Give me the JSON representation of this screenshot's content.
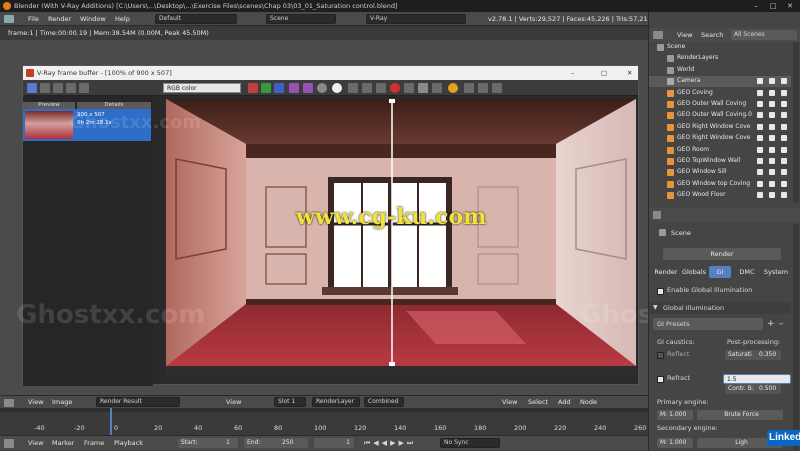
{
  "window": {
    "title": "Blender (With V-Ray Additions) [C:\\Users\\...\\Desktop\\...\\Exercise Files\\scenes\\Chap 03\\03_01_Saturation control.blend]",
    "minimize": "–",
    "maximize": "□",
    "close": "✕"
  },
  "infobar": {
    "menus": [
      "File",
      "Render",
      "Window",
      "Help"
    ],
    "layout": "Default",
    "scene": "Scene",
    "engine": "V-Ray",
    "stats": "v2.78.1 | Verts:29,527 | Faces:45,226 | Tris:57,210 | Objects:1/49 | Lamps:0/3 | Mem:38.56M | Camera"
  },
  "viewport": {
    "header": "frame:1 | Time:00:00.19 | Mem:38.54M (0.00M, Peak 45.50M)"
  },
  "vfb": {
    "title": "V-Ray frame buffer - [100% of 900 x 507]",
    "channel": "RGB color",
    "history": {
      "preview_label": "Preview",
      "details_label": "Details",
      "size": "900 x 507",
      "time": "0h 2m 28.1s"
    }
  },
  "outliner": {
    "tabs": [
      "View",
      "Search",
      "All Scenes"
    ],
    "items": [
      {
        "label": "Scene",
        "indent": 0
      },
      {
        "label": "RenderLayers",
        "indent": 1
      },
      {
        "label": "World",
        "indent": 1
      },
      {
        "label": "Camera",
        "indent": 1
      },
      {
        "label": "GEO Coving",
        "indent": 1
      },
      {
        "label": "GEO Outer Wall Coving",
        "indent": 1
      },
      {
        "label": "GEO Outer Wall Coving.0",
        "indent": 1
      },
      {
        "label": "GEO Right Window Cove",
        "indent": 1
      },
      {
        "label": "GEO Right Window Cove",
        "indent": 1
      },
      {
        "label": "GEO Room",
        "indent": 1
      },
      {
        "label": "GEO TopWindow Wall",
        "indent": 1
      },
      {
        "label": "GEO Window Sill",
        "indent": 1
      },
      {
        "label": "GEO Window top Coving",
        "indent": 1
      },
      {
        "label": "GEO Wood Floor",
        "indent": 1
      }
    ]
  },
  "properties": {
    "breadcrumb": "Scene",
    "render_button": "Render",
    "tabs": [
      "Render",
      "Globals",
      "GI",
      "DMC",
      "System"
    ],
    "active_tab": "GI",
    "enable_gi": "Enable Global Illumination",
    "panel_title": "Global Illumination",
    "gi_presets": "GI Presets",
    "gi_caustics": "GI caustics:",
    "reflect": "Reflect",
    "refract": "Refract",
    "post_processing": "Post-processing:",
    "saturation_label": "Saturati",
    "saturation_value": "0.350",
    "contrast_field": "1.5",
    "contrast_base_label": "Contr. B:",
    "contrast_base_value": "0.500",
    "primary_engine": "Primary engine:",
    "primary_mult": "M: 1.000",
    "primary_value": "Brute Force",
    "secondary_engine": "Secondary engine:",
    "secondary_mult": "M: 1.000",
    "secondary_value": "Ligh"
  },
  "uv_header": {
    "left": [
      "View",
      "Image"
    ],
    "render_result": "Render Result",
    "mid": [
      "View"
    ],
    "slot": "Slot 1",
    "layer": "RenderLayer",
    "pass": "Combined",
    "node_menus": [
      "View",
      "Select",
      "Add",
      "Node"
    ]
  },
  "timeline": {
    "ticks": [
      "-40",
      "-20",
      "0",
      "20",
      "40",
      "60",
      "80",
      "100",
      "120",
      "140",
      "160",
      "180",
      "200",
      "220",
      "240",
      "260"
    ],
    "current": "0"
  },
  "footer": {
    "menus": [
      "View",
      "Marker",
      "Frame",
      "Playback"
    ],
    "start_label": "Start:",
    "start_value": "1",
    "end_label": "End:",
    "end_value": "250",
    "current_value": "1",
    "sync": "No Sync"
  },
  "watermarks": {
    "site": "www.cg-ku.com",
    "ghost": "Ghostxx.com",
    "brand": "Linked"
  },
  "colors": {
    "accent": "#5680c2",
    "blender_orange": "#e87d0d",
    "watermark_yellow": "#f2e23a",
    "floor_red": "#b0353c"
  }
}
